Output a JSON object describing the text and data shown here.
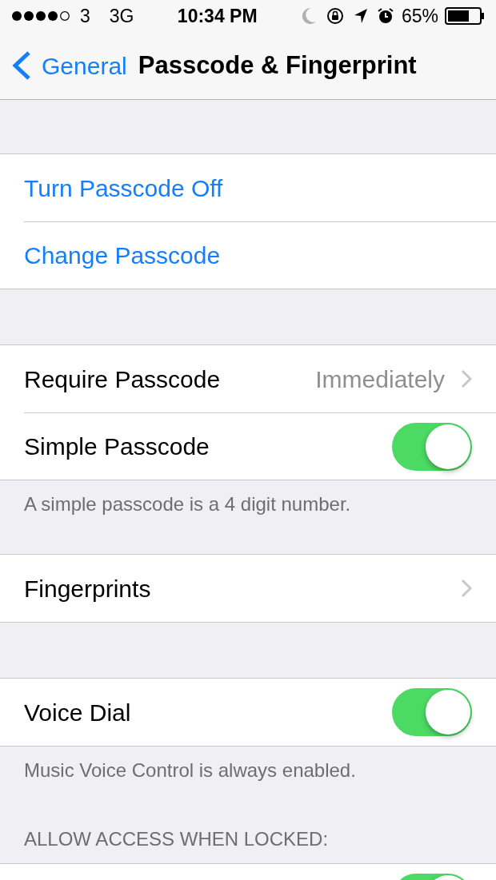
{
  "status_bar": {
    "carrier": "3",
    "network": "3G",
    "time": "10:34 PM",
    "battery": "65%"
  },
  "nav": {
    "back": "General",
    "title": "Passcode & Fingerprint"
  },
  "sections": [
    {
      "rows": [
        {
          "kind": "action",
          "label": "Turn Passcode Off"
        },
        {
          "kind": "action",
          "label": "Change Passcode"
        }
      ]
    },
    {
      "rows": [
        {
          "kind": "link",
          "label": "Require Passcode",
          "value": "Immediately"
        },
        {
          "kind": "toggle",
          "label": "Simple Passcode",
          "on": true
        }
      ],
      "footer": "A simple passcode is a 4 digit number."
    },
    {
      "rows": [
        {
          "kind": "link",
          "label": "Fingerprints"
        }
      ]
    },
    {
      "rows": [
        {
          "kind": "toggle",
          "label": "Voice Dial",
          "on": true
        }
      ],
      "footer": "Music Voice Control is always enabled."
    },
    {
      "header": "ALLOW ACCESS WHEN LOCKED:",
      "rows": [
        {
          "kind": "toggle",
          "on": true
        }
      ]
    }
  ]
}
